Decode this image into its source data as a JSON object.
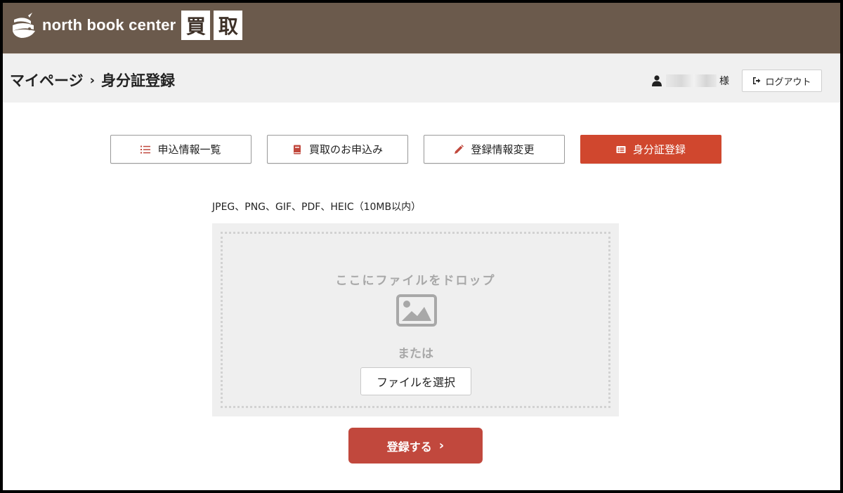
{
  "header": {
    "brand_name": "north book center",
    "kanji": [
      "買",
      "取"
    ],
    "bg_color": "#6b5a4c"
  },
  "breadcrumb": {
    "parent": "マイページ",
    "separator": "›",
    "current": "身分証登録"
  },
  "user": {
    "suffix": "様",
    "icon": "user-icon"
  },
  "logout": {
    "label": "ログアウト",
    "icon": "sign-out-icon"
  },
  "tabs": [
    {
      "label": "申込情報一覧",
      "icon": "list-icon",
      "active": false
    },
    {
      "label": "買取のお申込み",
      "icon": "book-icon",
      "active": false
    },
    {
      "label": "登録情報変更",
      "icon": "pencil-icon",
      "active": false
    },
    {
      "label": "身分証登録",
      "icon": "id-card-icon",
      "active": true
    }
  ],
  "upload": {
    "formats": "JPEG、PNG、GIF、PDF、HEIC（10MB以内）",
    "drop_text": "ここにファイルをドロップ",
    "or_text": "または",
    "choose_button": "ファイルを選択",
    "icon": "image-icon"
  },
  "submit": {
    "label": "登録する",
    "chevron": "›"
  },
  "colors": {
    "accent": "#d0472e",
    "submit": "#c1483d"
  }
}
